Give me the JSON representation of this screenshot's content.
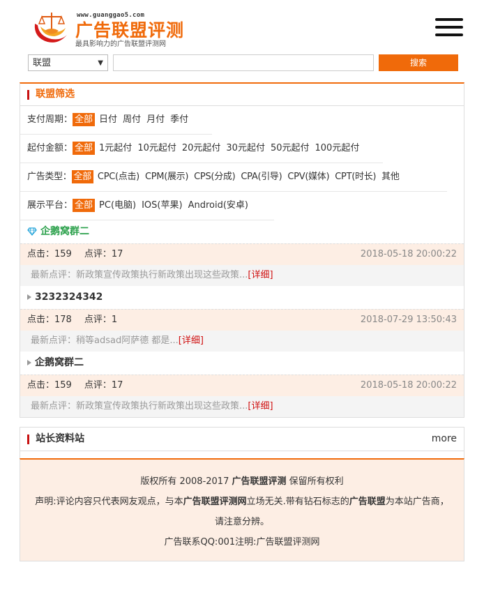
{
  "header": {
    "logo_url": "www.guanggao5.com",
    "logo_title": "广告联盟评测",
    "logo_slogan": "最具影响力的广告联盟评测网"
  },
  "search": {
    "select_value": "联盟",
    "input_value": "",
    "button_label": "搜索"
  },
  "filter": {
    "title": "联盟筛选",
    "rows": [
      {
        "label": "支付周期：",
        "options": [
          "全部",
          "日付",
          "周付",
          "月付",
          "季付"
        ]
      },
      {
        "label": "起付金额：",
        "options": [
          "全部",
          "1元起付",
          "10元起付",
          "20元起付",
          "30元起付",
          "50元起付",
          "100元起付"
        ]
      },
      {
        "label": "广告类型：",
        "options": [
          "全部",
          "CPC(点击)",
          "CPM(展示)",
          "CPS(分成)",
          "CPA(引导)",
          "CPV(媒体)",
          "CPT(时长)",
          "其他"
        ]
      },
      {
        "label": "展示平台：",
        "options": [
          "全部",
          "PC(电脑)",
          "IOS(苹果)",
          "Android(安卓)"
        ]
      }
    ]
  },
  "items": [
    {
      "title": "企鹅窝群二",
      "vip": true,
      "clicks": "点击：159",
      "comments": "点评：17",
      "date": "2018-05-18 20:00:22",
      "review": "最新点评：新政策宣传政策执行新政策出现这些政策...",
      "detail": "[详细]"
    },
    {
      "title": "3232324342",
      "vip": false,
      "clicks": "点击：178",
      "comments": "点评：1",
      "date": "2018-07-29 13:50:43",
      "review": "最新点评：稍等adsad阿萨德 都是...",
      "detail": "[详细]"
    },
    {
      "title": "企鹅窝群二",
      "vip": false,
      "clicks": "点击：159",
      "comments": "点评：17",
      "date": "2018-05-18 20:00:22",
      "review": "最新点评：新政策宣传政策执行新政策出现这些政策...",
      "detail": "[详细]"
    }
  ],
  "resources": {
    "title": "站长资料站",
    "more": "more"
  },
  "footer": {
    "line1_a": "版权所有 2008-2017 ",
    "line1_b": "广告联盟评测",
    "line1_c": " 保留所有权利",
    "line2_a": "声明:评论内容只代表网友观点，与本",
    "line2_b": "广告联盟评测网",
    "line2_c": "立场无关.带有钻石标志的",
    "line2_d": "广告联盟",
    "line2_e": "为本站广告商，",
    "line3": "请注意分辨。",
    "line4": "广告联系QQ:001注明:广告联盟评测网"
  },
  "colors": {
    "accent": "#f06a0a",
    "mark": "#c81010",
    "vip": "#2aa04a",
    "stats_bg": "#fdeee4"
  }
}
